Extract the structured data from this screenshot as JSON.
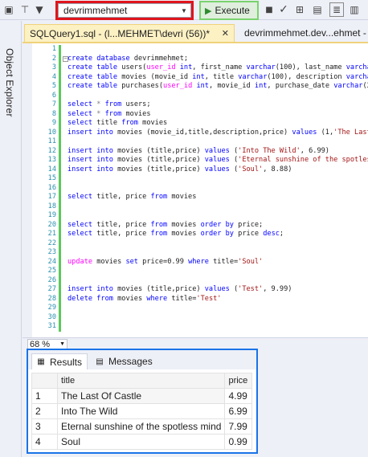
{
  "toolbar": {
    "database": "devrimmehmet",
    "execute_label": "Execute"
  },
  "sidebar": {
    "object_explorer_label": "Object Explorer"
  },
  "tabs": [
    {
      "label": "SQLQuery1.sql - (l...MEHMET\\devri (56))*",
      "close": "✕"
    },
    {
      "label": "devrimmehmet.dev...ehmet - "
    }
  ],
  "editor": {
    "line_numbers": [
      "1",
      "2",
      "3",
      "4",
      "5",
      "6",
      "7",
      "8",
      "9",
      "10",
      "11",
      "12",
      "13",
      "14",
      "15",
      "16",
      "17",
      "18",
      "19",
      "20",
      "21",
      "22",
      "23",
      "24",
      "25",
      "26",
      "27",
      "28",
      "29",
      "30",
      "31"
    ],
    "collapse_marker": "−"
  },
  "status": {
    "zoom": "68 %"
  },
  "results": {
    "tabs": {
      "results": "Results",
      "messages": "Messages"
    },
    "columns": [
      "title",
      "price"
    ],
    "rows": [
      {
        "n": "1",
        "title": "The Last Of Castle",
        "price": "4.99"
      },
      {
        "n": "2",
        "title": "Into The Wild",
        "price": "6.99"
      },
      {
        "n": "3",
        "title": "Eternal sunshine of the spotless mind",
        "price": "7.99"
      },
      {
        "n": "4",
        "title": "Soul",
        "price": "0.99"
      }
    ]
  },
  "colors": {
    "db_highlight": "#e0141b",
    "execute_highlight": "#79d36c",
    "results_highlight": "#1a73e8",
    "keyword": "#0000ff",
    "string": "#a31515",
    "function": "#ff00ff",
    "line_number": "#2b91af"
  }
}
